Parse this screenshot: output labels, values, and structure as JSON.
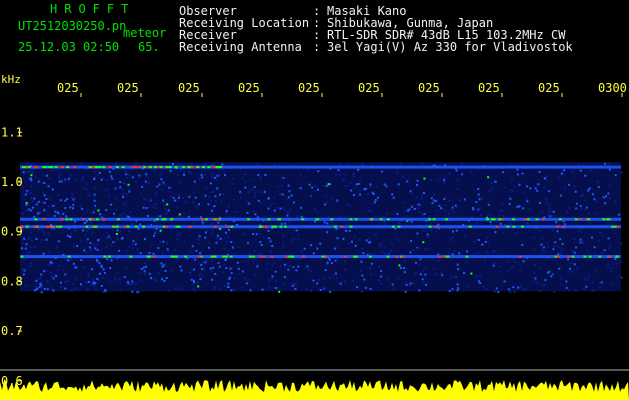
{
  "header": {
    "title": "HROFFT",
    "filename": "UT2512030250.pn",
    "mode": "meteor",
    "timestamp": "25.12.03 02:50",
    "count": "65.",
    "fields": [
      {
        "label": "Observer",
        "value": "Masaki Kano"
      },
      {
        "label": "Receiving Location",
        "value": "Shibukawa, Gunma, Japan"
      },
      {
        "label": "Receiver",
        "value": "RTL-SDR SDR# 43dB L15 103.2MHz CW"
      },
      {
        "label": "Receiving Antenna",
        "value": "3el Yagi(V) Az 330 for Vladivostok"
      }
    ]
  },
  "spectrogram": {
    "unit": "kHz",
    "y_ticks": [
      "1.1",
      "1.0",
      "0.9",
      "0.8",
      "0.7",
      "0.6"
    ],
    "y_tick_values": [
      1.1,
      1.0,
      0.9,
      0.8,
      0.7,
      0.6
    ],
    "x_ticks": [
      "025",
      "025",
      "025",
      "025",
      "025",
      "025",
      "025",
      "025",
      "025",
      "0300"
    ],
    "freq_range_khz": [
      0.6,
      1.13
    ],
    "bands_khz": [
      1.03,
      0.925,
      0.91,
      0.85
    ],
    "colors": {
      "low": "#0a1c8c",
      "mid": "#1e5aff",
      "high": "#18ff18",
      "peak": "#ff3030",
      "power": "#ffff00"
    }
  }
}
